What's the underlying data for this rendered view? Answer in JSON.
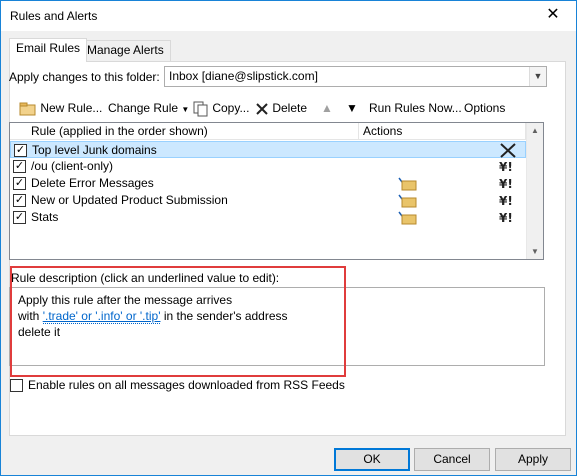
{
  "window": {
    "title": "Rules and Alerts",
    "close_glyph": "✕"
  },
  "tabs": [
    {
      "label": "Email Rules",
      "active": true
    },
    {
      "label": "Manage Alerts",
      "active": false
    }
  ],
  "folder": {
    "label": "Apply changes to this folder:",
    "value": "Inbox [diane@slipstick.com]"
  },
  "toolbar": {
    "new_rule": "New Rule...",
    "change_rule": "Change Rule",
    "copy": "Copy...",
    "delete": "Delete",
    "run_rules_now": "Run Rules Now...",
    "options": "Options"
  },
  "rules_list": {
    "columns": [
      "Rule (applied in the order shown)",
      "Actions"
    ],
    "rows": [
      {
        "name": "Top level Junk domains",
        "checked": true,
        "selected": true,
        "move_folder_icon": false,
        "exception_icon": "delete-x-icon"
      },
      {
        "name": "/ou  (client-only)",
        "checked": true,
        "selected": false,
        "move_folder_icon": false,
        "exception_icon": "exception-icon"
      },
      {
        "name": "Delete Error Messages",
        "checked": true,
        "selected": false,
        "move_folder_icon": true,
        "exception_icon": "exception-icon"
      },
      {
        "name": "New or Updated Product Submission",
        "checked": true,
        "selected": false,
        "move_folder_icon": true,
        "exception_icon": "exception-icon"
      },
      {
        "name": "Stats",
        "checked": true,
        "selected": false,
        "move_folder_icon": true,
        "exception_icon": "exception-icon"
      }
    ]
  },
  "description": {
    "label": "Rule description (click an underlined value to edit):",
    "line1": "Apply this rule after the message arrives",
    "line2_prefix": "with ",
    "line2_link": "'.trade' or '.info' or '.tip'",
    "line2_suffix": " in the sender's address",
    "line3": "delete it"
  },
  "rss": {
    "label": "Enable rules on all messages downloaded from RSS Feeds",
    "checked": false
  },
  "buttons": {
    "ok": "OK",
    "cancel": "Cancel",
    "apply": "Apply"
  },
  "colors": {
    "accent": "#0078d7",
    "highlight_border": "#e03c3c",
    "selected_row": "#cce8ff",
    "link": "#0066cc"
  }
}
